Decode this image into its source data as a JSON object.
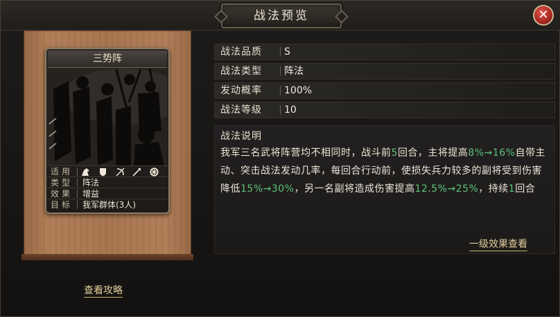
{
  "window": {
    "title": "战法预览"
  },
  "close": {
    "glyph": "✕"
  },
  "card": {
    "name": "三势阵",
    "rows": [
      {
        "label": "适用",
        "value": ""
      },
      {
        "label": "类型",
        "value": "阵法"
      },
      {
        "label": "效果",
        "value": "增益"
      },
      {
        "label": "目标",
        "value": "我军群体(3人)"
      }
    ],
    "troop_icons": [
      "cavalry-icon",
      "shield-icon",
      "archer-icon",
      "spear-icon",
      "siege-icon"
    ]
  },
  "links": {
    "guide": "查看攻略",
    "level_effect": "一级效果查看"
  },
  "info": [
    {
      "label": "战法品质",
      "value": "S"
    },
    {
      "label": "战法类型",
      "value": "阵法"
    },
    {
      "label": "发动概率",
      "value": "100%"
    },
    {
      "label": "战法等级",
      "value": "10"
    }
  ],
  "description": {
    "title": "战法说明",
    "parts": [
      {
        "text": "我军三名武将阵营均不相同时，战斗前",
        "hl": false
      },
      {
        "text": "5",
        "hl": true
      },
      {
        "text": "回合，主将提高",
        "hl": false
      },
      {
        "text": "8%→16%",
        "hl": true
      },
      {
        "text": "自带主动、突击战法发动几率，每回合行动前，使损失兵力较多的副将受到伤害降低",
        "hl": false
      },
      {
        "text": "15%→30%",
        "hl": true
      },
      {
        "text": "，另一名副将造成伤害提高",
        "hl": false
      },
      {
        "text": "12.5%→25%",
        "hl": true
      },
      {
        "text": "，持续",
        "hl": false
      },
      {
        "text": "1",
        "hl": true
      },
      {
        "text": "回合",
        "hl": false
      }
    ]
  },
  "colors": {
    "highlight": "#5fc27a",
    "link": "#e4cfa0",
    "scroll": "#a77650"
  }
}
